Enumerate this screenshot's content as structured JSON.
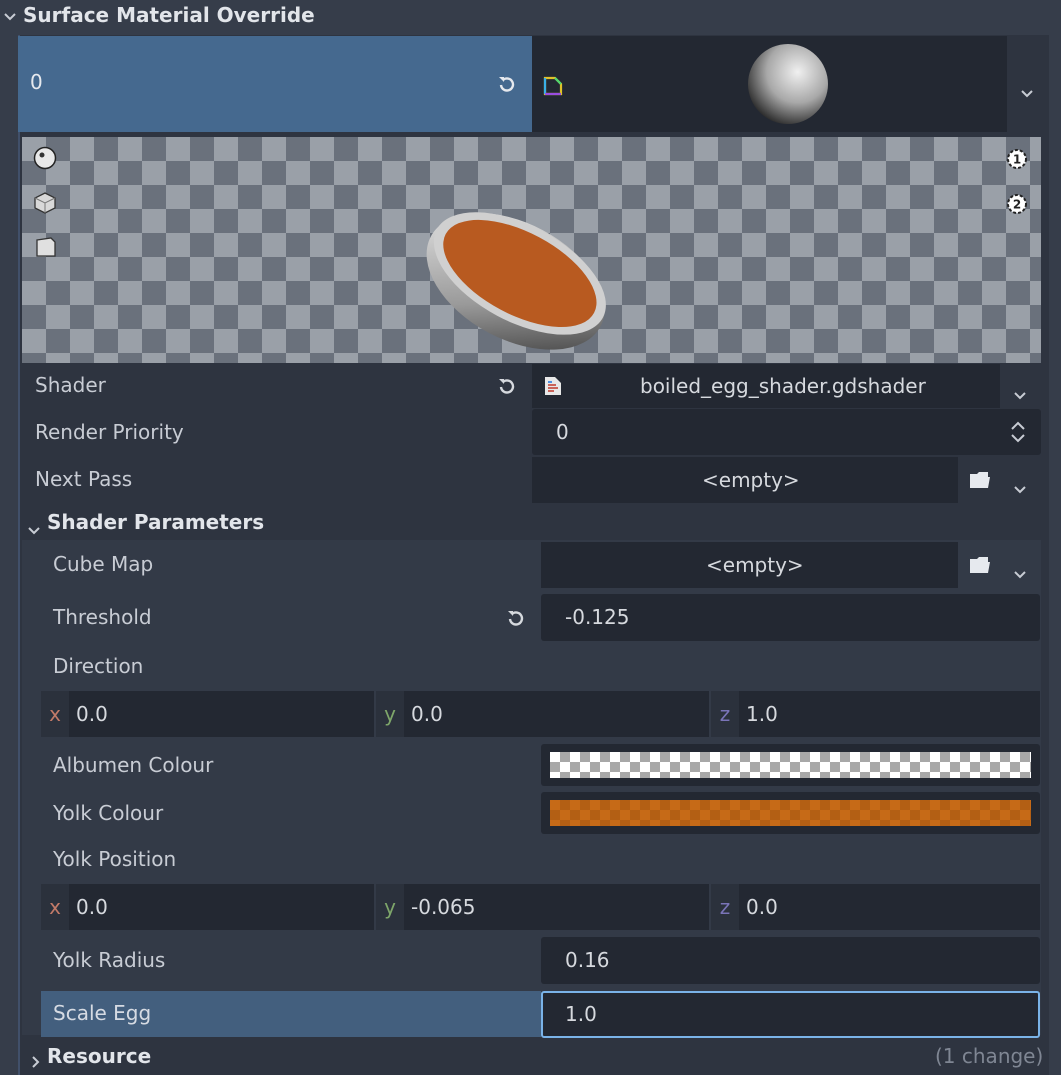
{
  "section": {
    "title": "Surface Material Override"
  },
  "slot": {
    "index": "0"
  },
  "shader": {
    "label": "Shader",
    "value": "boiled_egg_shader.gdshader"
  },
  "render_priority": {
    "label": "Render Priority",
    "value": "0"
  },
  "next_pass": {
    "label": "Next Pass",
    "value": "<empty>"
  },
  "shader_params": {
    "title": "Shader Parameters",
    "cube_map": {
      "label": "Cube Map",
      "value": "<empty>"
    },
    "threshold": {
      "label": "Threshold",
      "value": "-0.125"
    },
    "direction": {
      "label": "Direction",
      "x_label": "x",
      "x": "0.0",
      "y_label": "y",
      "y": "0.0",
      "z_label": "z",
      "z": "1.0"
    },
    "albumen_colour": {
      "label": "Albumen Colour",
      "color": "#ffffff"
    },
    "yolk_colour": {
      "label": "Yolk Colour",
      "color": "#c66a17"
    },
    "yolk_position": {
      "label": "Yolk Position",
      "x_label": "x",
      "x": "0.0",
      "y_label": "y",
      "y": "-0.065",
      "z_label": "z",
      "z": "0.0"
    },
    "yolk_radius": {
      "label": "Yolk Radius",
      "value": "0.16"
    },
    "scale_egg": {
      "label": "Scale Egg",
      "value": "1.0"
    }
  },
  "resource": {
    "title": "Resource",
    "changes": "(1 change)"
  },
  "icons": [
    "chevron-down-icon",
    "reset-icon",
    "shader-material-icon",
    "sphere-preview-icon",
    "light-1-icon",
    "light-2-icon",
    "cube-preview-icon",
    "quad-preview-icon",
    "shader-file-icon",
    "spin-arrows-icon",
    "folder-icon",
    "chevron-right-icon"
  ],
  "colors": {
    "accent": "#45698f",
    "axis_x": "#c27a68",
    "axis_y": "#7ea66a",
    "axis_z": "#7a74b8",
    "yolk": "#b65a1f"
  }
}
